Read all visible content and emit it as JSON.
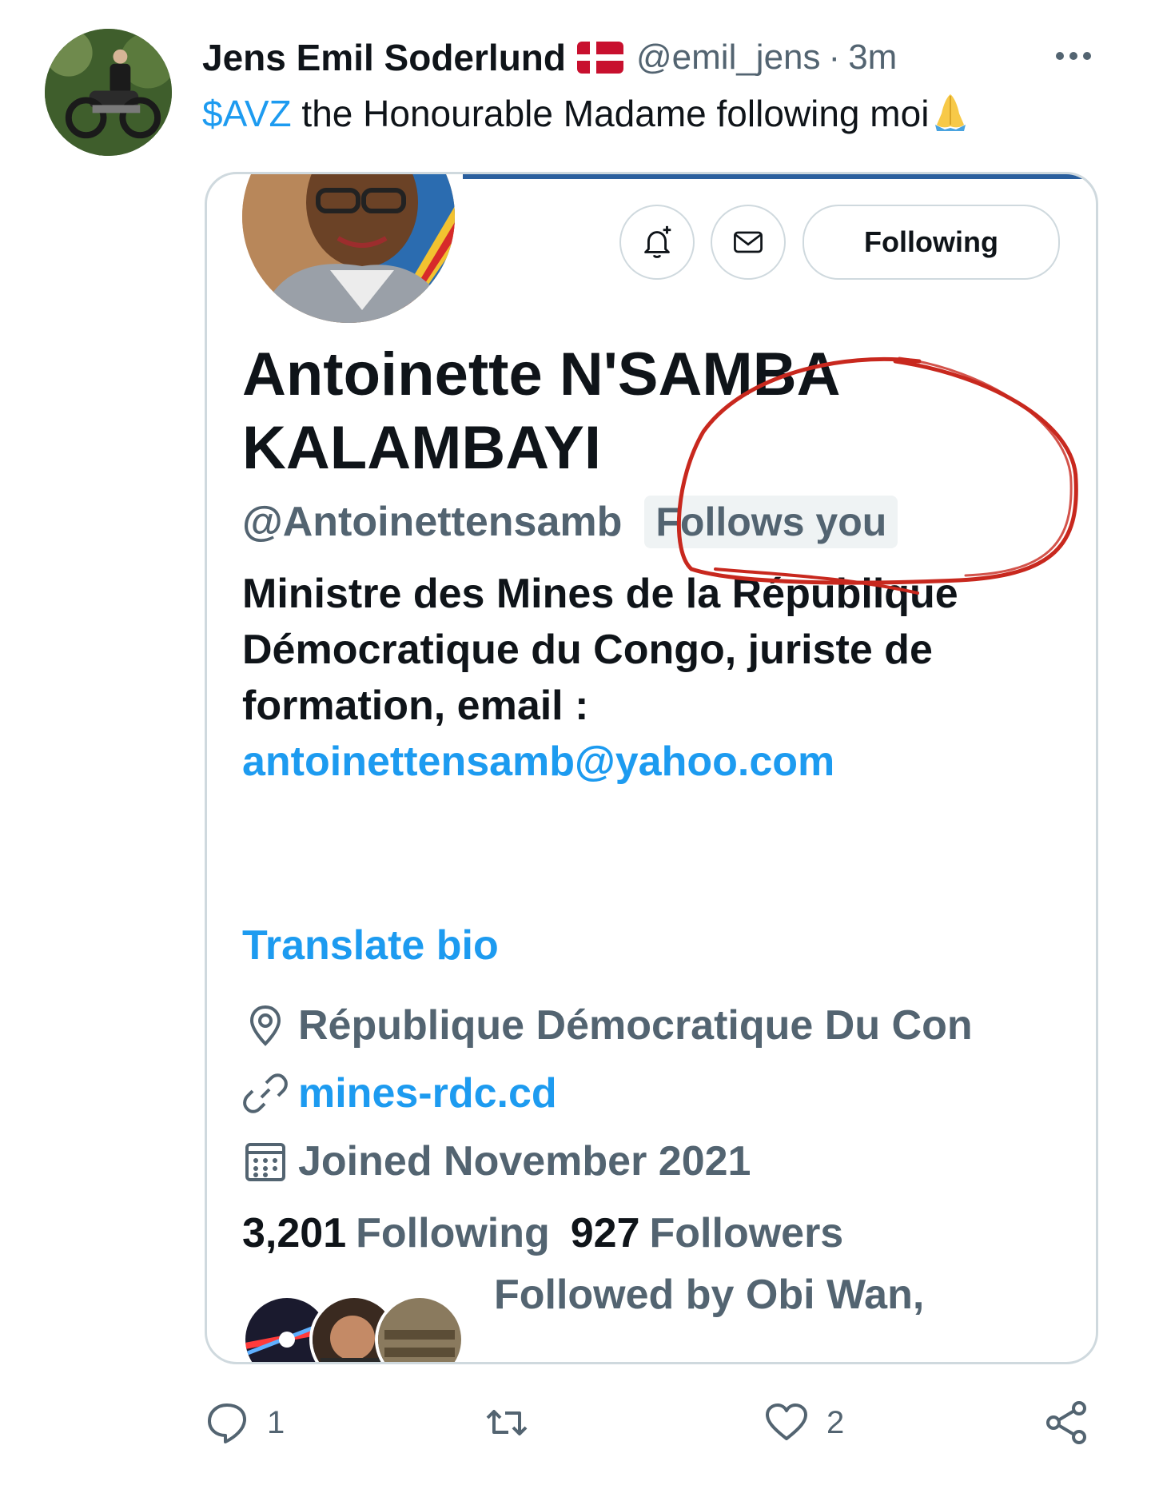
{
  "tweet": {
    "author_name": "Jens Emil Soderlund",
    "handle": "@emil_jens",
    "separator": "·",
    "time": "3m",
    "cashtag": "$AVZ",
    "text": " the Honourable Madame following moi"
  },
  "card": {
    "follow_button": "Following",
    "profile_name": "Antoinette N'SAMBA KALAMBAYI",
    "profile_handle": "@Antoinettensamb",
    "follows_you": "Follows you",
    "bio_text": "Ministre des Mines de la République Démocratique du Congo, juriste de formation, email : ",
    "bio_email": "antoinettensamb@yahoo.com",
    "translate_bio": "Translate bio",
    "location": "République Démocratique Du Con",
    "website": "mines-rdc.cd",
    "joined": "Joined November 2021",
    "following_count": "3,201",
    "following_label": "Following",
    "followers_count": "927",
    "followers_label": "Followers",
    "followed_by": "Followed by Obi Wan,"
  },
  "actions": {
    "reply_count": "1",
    "like_count": "2"
  },
  "colors": {
    "accent": "#1d9bf0",
    "secondary_text": "#536471",
    "annotation": "#c8281e"
  }
}
